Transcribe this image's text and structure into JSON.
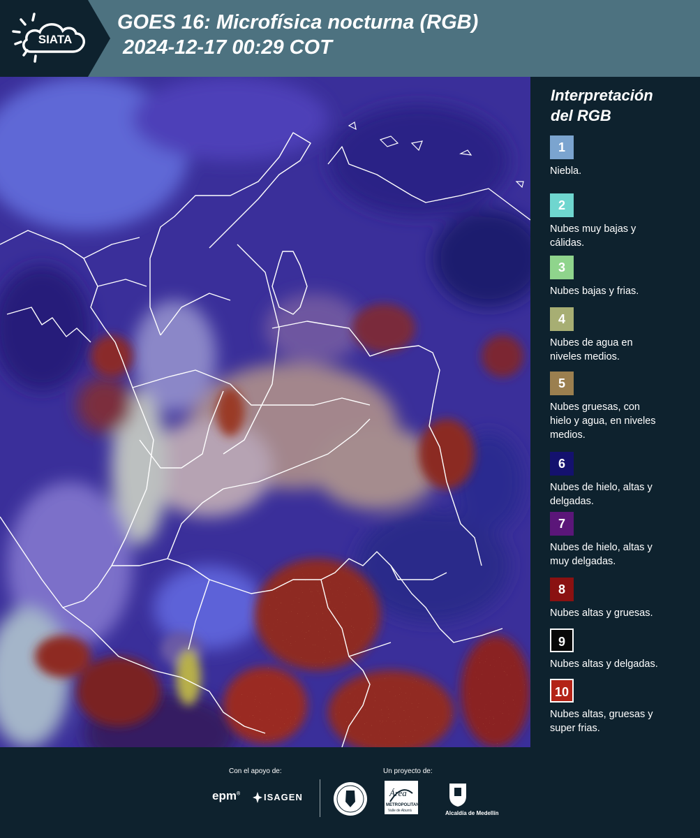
{
  "header": {
    "brand": "SIATA",
    "title_line1": "GOES 16: Microfísica nocturna (RGB)",
    "title_line2": "2024-12-17 00:29 COT"
  },
  "legend": {
    "title_line1": "Interpretación",
    "title_line2": "del RGB",
    "items": [
      {
        "num": "1",
        "line1": "Niebla.",
        "line2": "",
        "line3": "",
        "color": "#7ba4cf"
      },
      {
        "num": "2",
        "line1": "Nubes muy bajas y",
        "line2": "cálidas.",
        "line3": "",
        "color": "#6fd6cf"
      },
      {
        "num": "3",
        "line1": "Nubes bajas y frias.",
        "line2": "",
        "line3": "",
        "color": "#8fd48c"
      },
      {
        "num": "4",
        "line1": "Nubes de agua en",
        "line2": "niveles medios.",
        "line3": "",
        "color": "#a7ae73"
      },
      {
        "num": "5",
        "line1": "Nubes gruesas, con",
        "line2": "hielo y agua, en niveles",
        "line3": "medios.",
        "color": "#9b7f4f"
      },
      {
        "num": "6",
        "line1": "Nubes de hielo, altas y",
        "line2": "delgadas.",
        "line3": "",
        "color": "#14116e"
      },
      {
        "num": "7",
        "line1": "Nubes de hielo, altas y",
        "line2": "muy delgadas.",
        "line3": "",
        "color": "#5b1679"
      },
      {
        "num": "8",
        "line1": "Nubes altas y gruesas.",
        "line2": "",
        "line3": "",
        "color": "#8a1111"
      },
      {
        "num": "9",
        "line1": "Nubes altas y delgadas.",
        "line2": "",
        "line3": "",
        "color": "#080808"
      },
      {
        "num": "10",
        "line1": "Nubes altas, gruesas y",
        "line2": "super frias.",
        "line3": "",
        "color": "#b32317"
      }
    ]
  },
  "footer": {
    "support_caption": "Con el apoyo de:",
    "project_caption": "Un proyecto de:",
    "epm": "epm",
    "isagen": "ISAGEN",
    "area_script": "Área",
    "area_name": "METROPOLITANA",
    "area_sub": "Valle de Aburrá",
    "alcaldia": "Alcaldía de Medellín"
  }
}
